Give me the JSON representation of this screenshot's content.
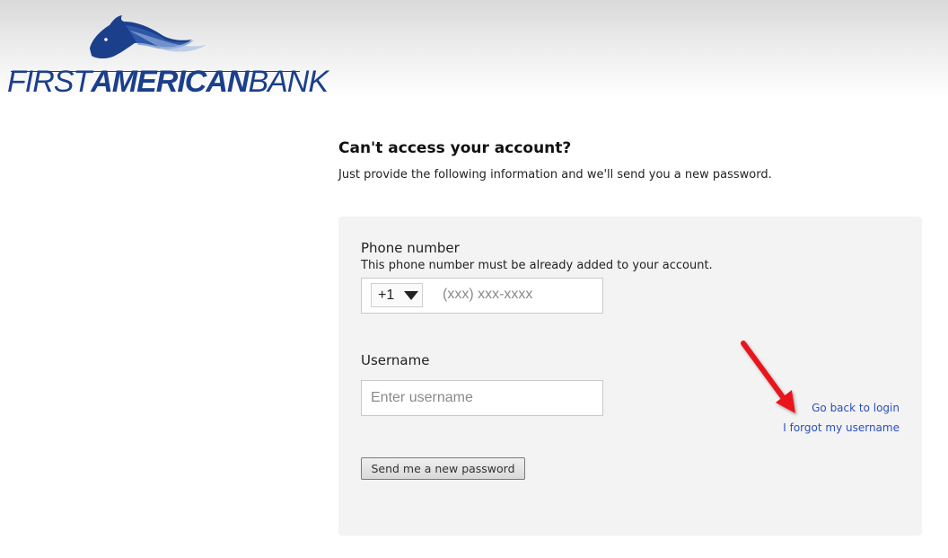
{
  "logo": {
    "word_first": "FIRST",
    "word_american": "AMERICAN",
    "word_bank": "BANK",
    "brand_color": "#1b3f8b",
    "accent_color": "#c8102e",
    "icon": "horse-head-icon"
  },
  "heading": {
    "title": "Can't access your account?",
    "subtitle": "Just provide the following information and we'll send you a new password."
  },
  "form": {
    "phone_label": "Phone number",
    "phone_helper": "This phone number must be already added to your account.",
    "country_code": "+1",
    "phone_placeholder": "(xxx) xxx-xxxx",
    "phone_value": "",
    "username_label": "Username",
    "username_placeholder": "Enter username",
    "username_value": "",
    "submit_label": "Send me a new password"
  },
  "links": {
    "back_to_login": "Go back to login",
    "forgot_username": "I forgot my username"
  },
  "annotation": {
    "icon": "red-arrow-icon",
    "color": "#e8141b"
  }
}
